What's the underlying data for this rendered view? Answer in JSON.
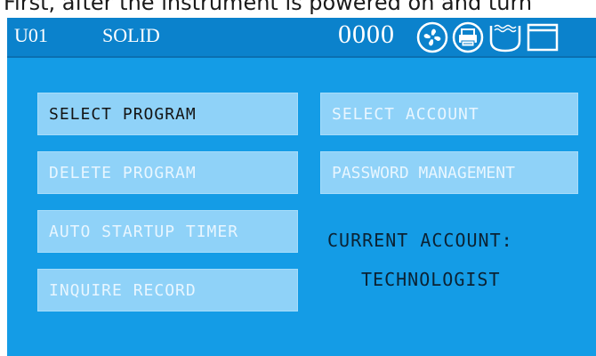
{
  "caption": "First, after the instrument is powered on and turn",
  "status_bar": {
    "unit": "U01",
    "mode": "SOLID",
    "counter": "0000",
    "icons": [
      "fan-icon",
      "printer-icon",
      "water-bath-icon",
      "window-icon"
    ]
  },
  "menu": {
    "select_program": "SELECT PROGRAM",
    "delete_program": "DELETE PROGRAM",
    "auto_startup_timer": "AUTO STARTUP TIMER",
    "inquire_record": "INQUIRE RECORD",
    "select_account": "SELECT ACCOUNT",
    "password_management": "PASSWORD MANAGEMENT"
  },
  "account": {
    "label": "CURRENT ACCOUNT:",
    "value": "TECHNOLOGIST"
  },
  "colors": {
    "screen_bg": "#149ce6",
    "button_bg": "#8fd2f8",
    "active_text": "#141414",
    "disabled_text": "#e8f6ff"
  }
}
